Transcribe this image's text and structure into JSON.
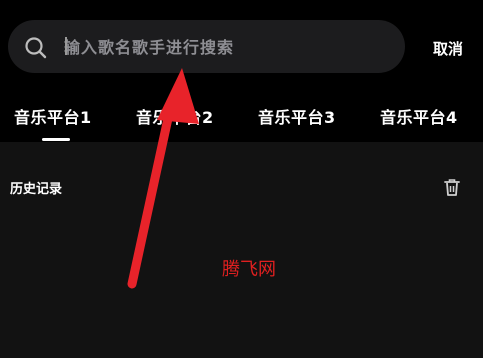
{
  "search": {
    "placeholder": "输入歌名歌手进行搜索",
    "value": "",
    "cancel_label": "取消"
  },
  "icons": {
    "search": "search-icon",
    "trash": "trash-icon",
    "annotation_arrow": "red-arrow"
  },
  "tabs": [
    {
      "label": "音乐平台1",
      "selected": true
    },
    {
      "label": "音乐平台2",
      "selected": false
    },
    {
      "label": "音乐平台3",
      "selected": false
    },
    {
      "label": "音乐平台4",
      "selected": false
    }
  ],
  "history": {
    "title": "历史记录"
  },
  "watermark": "腾飞网",
  "colors": {
    "background": "#000000",
    "panel": "#121212",
    "search_bar": "#1c1c1e",
    "placeholder": "#8e8e93",
    "arrow": "#e8232a",
    "watermark": "#e02020"
  }
}
